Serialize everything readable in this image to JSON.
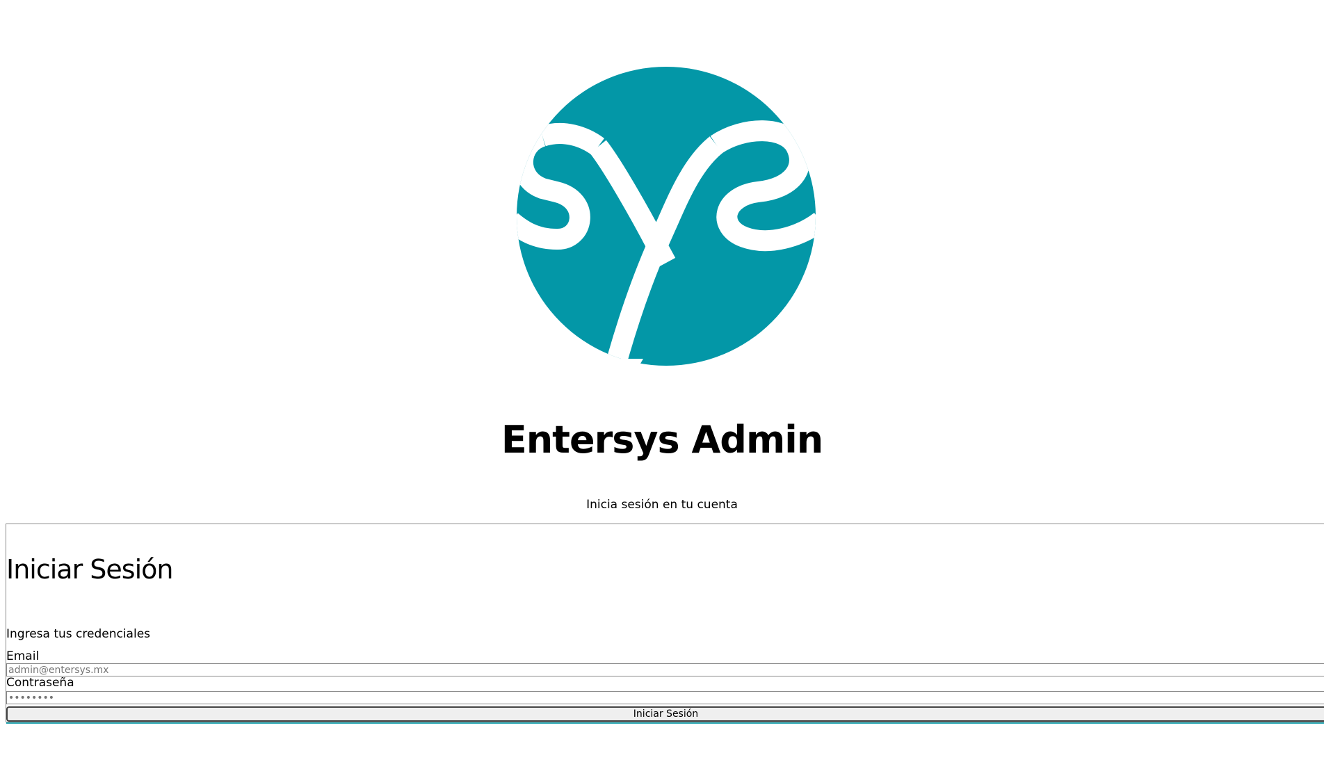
{
  "brand": {
    "logo_icon": "entersys-sys-logo-icon",
    "logo_color": "#0397a7",
    "title": "Entersys Admin",
    "subtitle": "Inicia sesión en tu cuenta"
  },
  "login_card": {
    "title": "Iniciar Sesión",
    "description": "Ingresa tus credenciales",
    "email": {
      "label": "Email",
      "placeholder": "admin@entersys.mx",
      "value": ""
    },
    "password": {
      "label": "Contraseña",
      "placeholder": "••••••••",
      "value": ""
    },
    "submit_label": "Iniciar Sesión",
    "accent_color": "#2aa9b4"
  }
}
